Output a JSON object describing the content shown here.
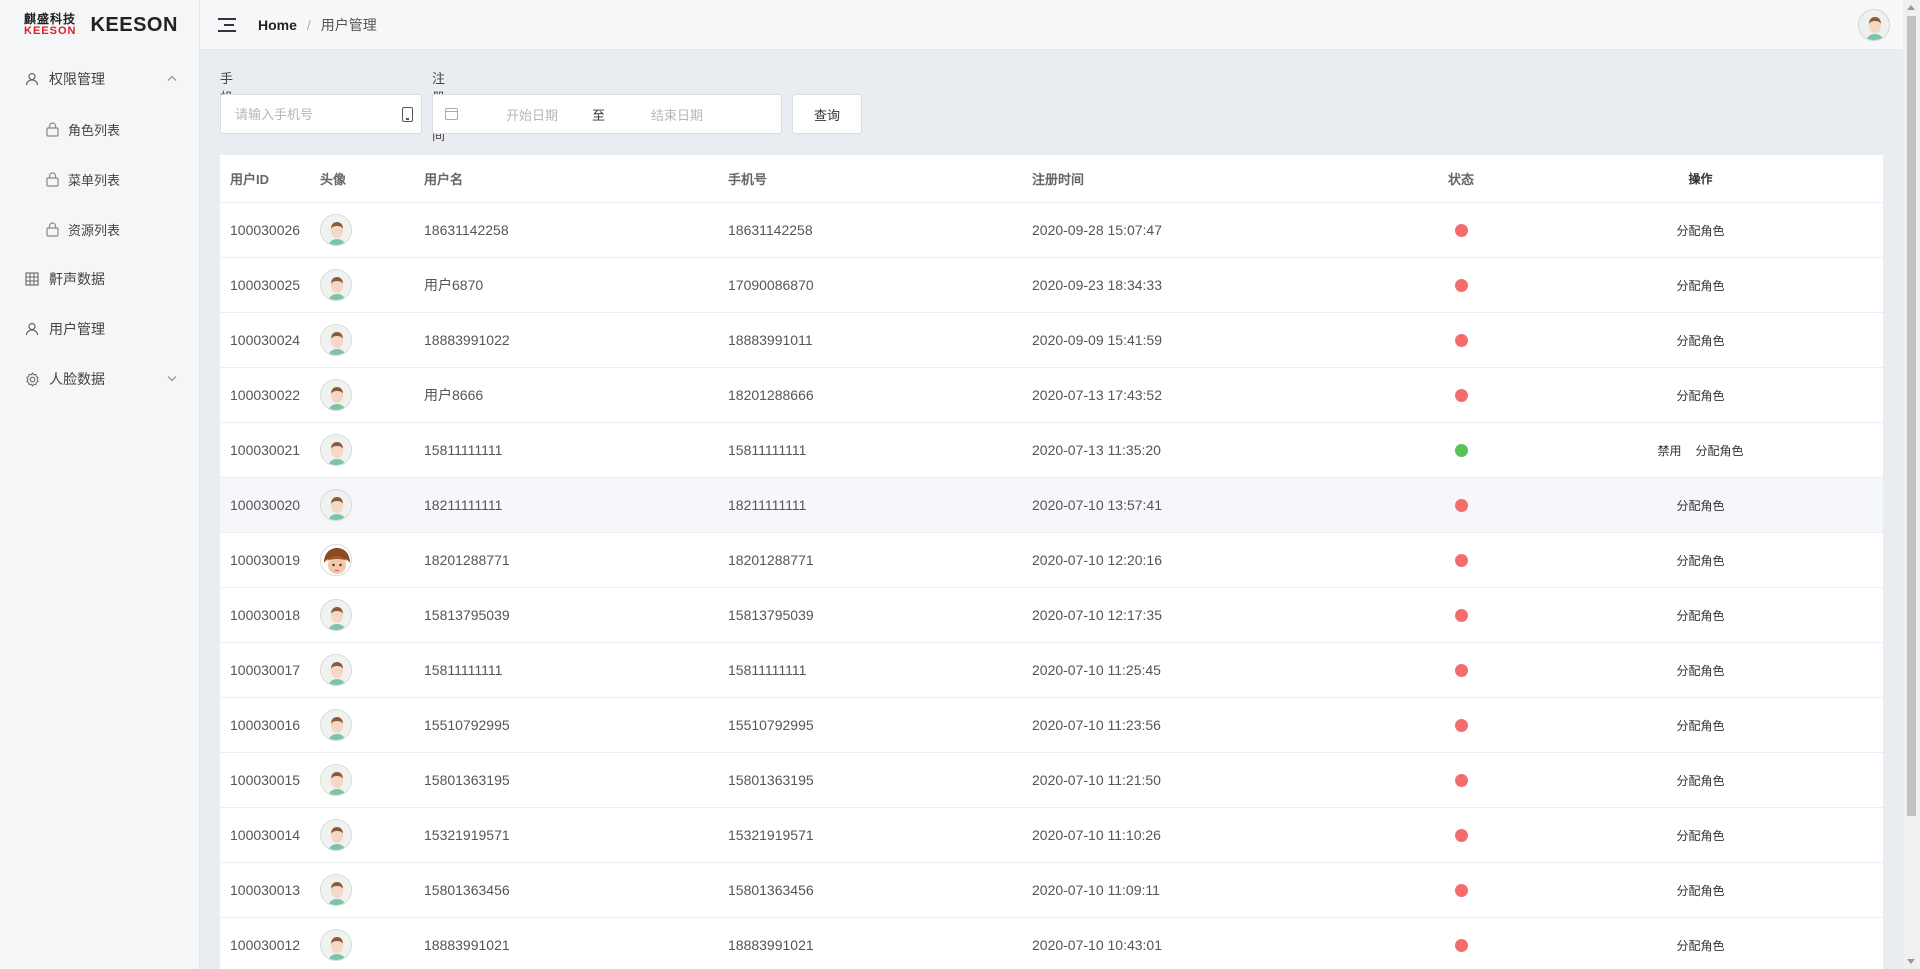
{
  "logo": {
    "cn": "麒盛科技",
    "en": "KEESON",
    "text": "KEESON"
  },
  "sidebar": {
    "items": [
      {
        "label": "权限管理",
        "icon": "user-icon",
        "expanded": true,
        "children": [
          {
            "label": "角色列表",
            "icon": "lock-icon"
          },
          {
            "label": "菜单列表",
            "icon": "lock-icon"
          },
          {
            "label": "资源列表",
            "icon": "lock-icon"
          }
        ]
      },
      {
        "label": "鼾声数据",
        "icon": "table-icon"
      },
      {
        "label": "用户管理",
        "icon": "user-icon"
      },
      {
        "label": "人脸数据",
        "icon": "gear-icon",
        "expanded": false
      }
    ]
  },
  "header": {
    "breadcrumb": {
      "home": "Home",
      "separator": "/",
      "current": "用户管理"
    }
  },
  "filters": {
    "phone_label": "手机号",
    "phone_placeholder": "请输入手机号",
    "date_label": "注册时间",
    "start_placeholder": "开始日期",
    "range_sep": "至",
    "end_placeholder": "结束日期",
    "query_label": "查询"
  },
  "table": {
    "columns": [
      "用户ID",
      "头像",
      "用户名",
      "手机号",
      "注册时间",
      "状态",
      "操作"
    ],
    "rows": [
      {
        "id": "100030026",
        "avatar": "default",
        "name": "18631142258",
        "phone": "18631142258",
        "time": "2020-09-28 15:07:47",
        "status": "red",
        "ops": [
          "分配角色"
        ]
      },
      {
        "id": "100030025",
        "avatar": "default",
        "name": "用户6870",
        "phone": "17090086870",
        "time": "2020-09-23 18:34:33",
        "status": "red",
        "ops": [
          "分配角色"
        ]
      },
      {
        "id": "100030024",
        "avatar": "default",
        "name": "18883991022",
        "phone": "18883991011",
        "time": "2020-09-09 15:41:59",
        "status": "red",
        "ops": [
          "分配角色"
        ]
      },
      {
        "id": "100030022",
        "avatar": "default",
        "name": "用户8666",
        "phone": "18201288666",
        "time": "2020-07-13 17:43:52",
        "status": "red",
        "ops": [
          "分配角色"
        ]
      },
      {
        "id": "100030021",
        "avatar": "default",
        "name": "15811111111",
        "phone": "15811111111",
        "time": "2020-07-13 11:35:20",
        "status": "green",
        "ops": [
          "禁用",
          "分配角色"
        ]
      },
      {
        "id": "100030020",
        "avatar": "default",
        "name": "18211111111",
        "phone": "18211111111",
        "time": "2020-07-10 13:57:41",
        "status": "red",
        "ops": [
          "分配角色"
        ],
        "hover": true
      },
      {
        "id": "100030019",
        "avatar": "custom",
        "name": "18201288771",
        "phone": "18201288771",
        "time": "2020-07-10 12:20:16",
        "status": "red",
        "ops": [
          "分配角色"
        ]
      },
      {
        "id": "100030018",
        "avatar": "default",
        "name": "15813795039",
        "phone": "15813795039",
        "time": "2020-07-10 12:17:35",
        "status": "red",
        "ops": [
          "分配角色"
        ]
      },
      {
        "id": "100030017",
        "avatar": "default",
        "name": "15811111111",
        "phone": "15811111111",
        "time": "2020-07-10 11:25:45",
        "status": "red",
        "ops": [
          "分配角色"
        ]
      },
      {
        "id": "100030016",
        "avatar": "default",
        "name": "15510792995",
        "phone": "15510792995",
        "time": "2020-07-10 11:23:56",
        "status": "red",
        "ops": [
          "分配角色"
        ]
      },
      {
        "id": "100030015",
        "avatar": "default",
        "name": "15801363195",
        "phone": "15801363195",
        "time": "2020-07-10 11:21:50",
        "status": "red",
        "ops": [
          "分配角色"
        ]
      },
      {
        "id": "100030014",
        "avatar": "default",
        "name": "15321919571",
        "phone": "15321919571",
        "time": "2020-07-10 11:10:26",
        "status": "red",
        "ops": [
          "分配角色"
        ]
      },
      {
        "id": "100030013",
        "avatar": "default",
        "name": "15801363456",
        "phone": "15801363456",
        "time": "2020-07-10 11:09:11",
        "status": "red",
        "ops": [
          "分配角色"
        ]
      },
      {
        "id": "100030012",
        "avatar": "default",
        "name": "18883991021",
        "phone": "18883991021",
        "time": "2020-07-10 10:43:01",
        "status": "red",
        "ops": [
          "分配角色"
        ]
      }
    ]
  },
  "colors": {
    "status_red": "#f56c6c",
    "status_green": "#55c55a",
    "logo_red": "#d4232b"
  }
}
